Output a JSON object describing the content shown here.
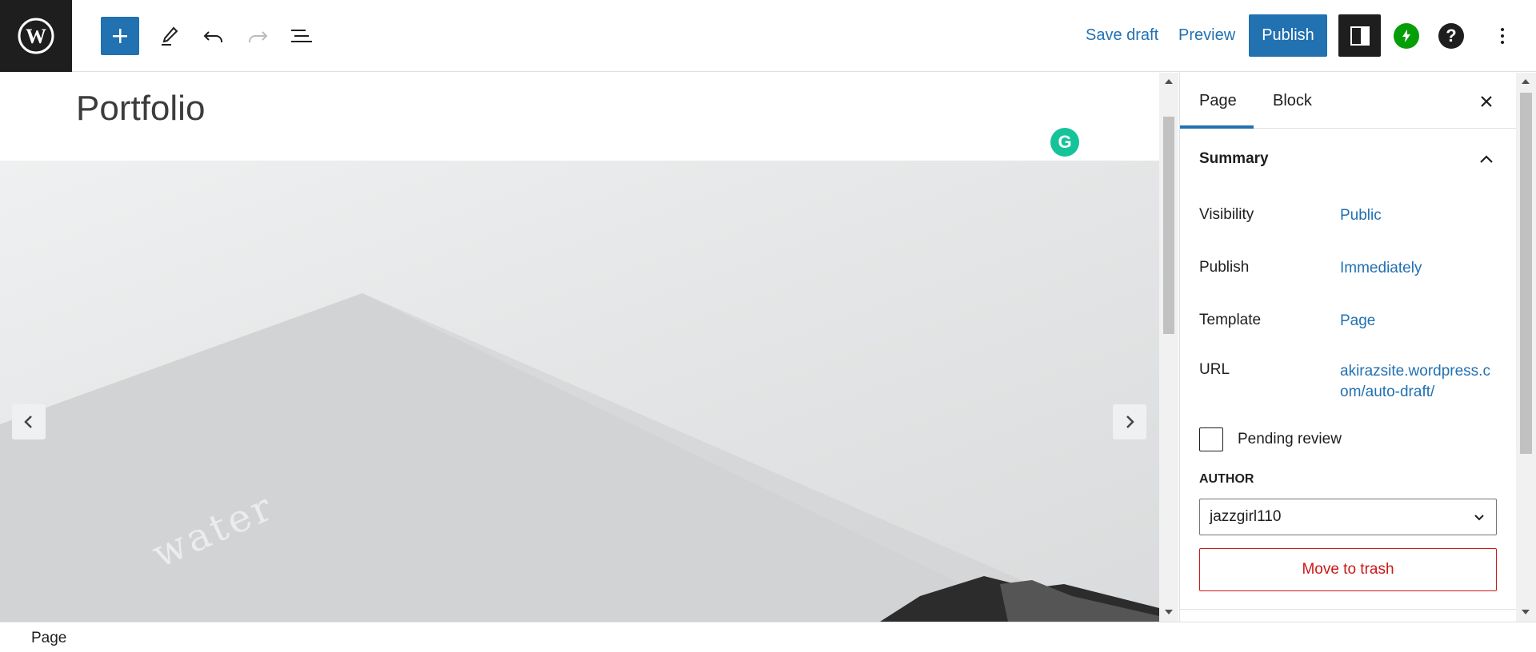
{
  "toolbar": {
    "save_draft": "Save draft",
    "preview": "Preview",
    "publish": "Publish",
    "help_glyph": "?",
    "icons": [
      "wordpress-logo-icon",
      "plus-icon",
      "pencil-icon",
      "undo-icon",
      "redo-icon",
      "list-view-icon",
      "sidebar-toggle-icon",
      "jetpack-icon",
      "help-icon",
      "more-vertical-icon"
    ]
  },
  "editor": {
    "page_title": "Portfolio",
    "grammarly_glyph": "G",
    "slider_image_text": "water"
  },
  "sidebar": {
    "tabs": [
      "Page",
      "Block"
    ],
    "active_tab": "Page",
    "summary_title": "Summary",
    "rows": [
      {
        "label": "Visibility",
        "value": "Public"
      },
      {
        "label": "Publish",
        "value": "Immediately"
      },
      {
        "label": "Template",
        "value": "Page"
      },
      {
        "label": "URL",
        "value": "akirazsite.wordpress.com/auto-draft/"
      }
    ],
    "url_line1": "akirazsite.wordpress.c",
    "url_line2": "om/auto-draft/",
    "pending_review": "Pending review",
    "author_label": "AUTHOR",
    "author_value": "jazzgirl110",
    "move_to_trash": "Move to trash"
  },
  "footer": {
    "breadcrumb": "Page"
  },
  "colors": {
    "accent": "#2271b1",
    "danger": "#cc1818",
    "jetpack": "#069e08",
    "grammarly": "#15c39a",
    "dark": "#1e1e1e"
  }
}
